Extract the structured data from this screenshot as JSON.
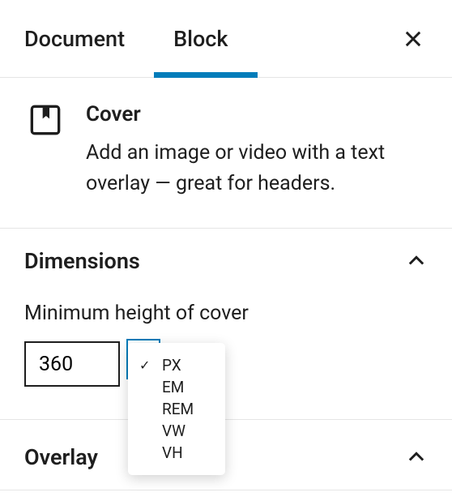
{
  "tabs": {
    "document": "Document",
    "block": "Block",
    "active": "block"
  },
  "block": {
    "title": "Cover",
    "description": "Add an image or video with a text overlay — great for headers."
  },
  "panels": {
    "dimensions": {
      "title": "Dimensions",
      "min_height_label": "Minimum height of cover",
      "min_height_value": "360"
    },
    "overlay": {
      "title": "Overlay"
    }
  },
  "unit_dropdown": {
    "options": [
      "PX",
      "EM",
      "REM",
      "VW",
      "VH"
    ],
    "selected": "PX"
  }
}
